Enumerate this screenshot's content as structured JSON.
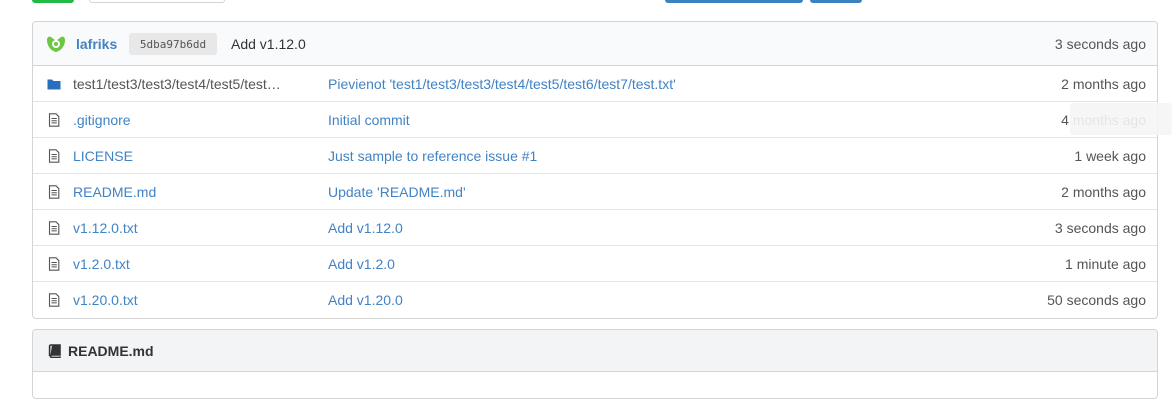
{
  "latest_commit": {
    "author": "lafriks",
    "sha": "5dba97b6dd",
    "message": "Add v1.12.0",
    "time": "3 seconds ago"
  },
  "files": [
    {
      "name": "test1/test3/test3/test4/test5/test6/test7",
      "display_name": "test1/test3/test3/test4/test5/test…",
      "type": "directory",
      "icon": "folder-icon",
      "commit": "Pievienot 'test1/test3/test3/test4/test5/test6/test7/test.txt'",
      "time": "2 months ago"
    },
    {
      "name": ".gitignore",
      "display_name": ".gitignore",
      "type": "file",
      "icon": "file-text-icon",
      "commit": "Initial commit",
      "time": "4 months ago"
    },
    {
      "name": "LICENSE",
      "display_name": "LICENSE",
      "type": "file",
      "icon": "file-text-icon",
      "commit": "Just sample to reference issue #1",
      "time": "1 week ago"
    },
    {
      "name": "README.md",
      "display_name": "README.md",
      "type": "file",
      "icon": "file-text-icon",
      "commit": "Update 'README.md'",
      "time": "2 months ago"
    },
    {
      "name": "v1.12.0.txt",
      "display_name": "v1.12.0.txt",
      "type": "file",
      "icon": "file-text-icon",
      "commit": "Add v1.12.0",
      "time": "3 seconds ago"
    },
    {
      "name": "v1.2.0.txt",
      "display_name": "v1.2.0.txt",
      "type": "file",
      "icon": "file-text-icon",
      "commit": "Add v1.2.0",
      "time": "1 minute ago"
    },
    {
      "name": "v1.20.0.txt",
      "display_name": "v1.20.0.txt",
      "type": "file",
      "icon": "file-text-icon",
      "commit": "Add v1.20.0",
      "time": "50 seconds ago"
    }
  ],
  "readme": {
    "title": "README.md",
    "icon": "book-icon"
  },
  "colors": {
    "link": "#4183c4",
    "border": "#d4d4d5",
    "header_bg": "#f9fafb"
  }
}
